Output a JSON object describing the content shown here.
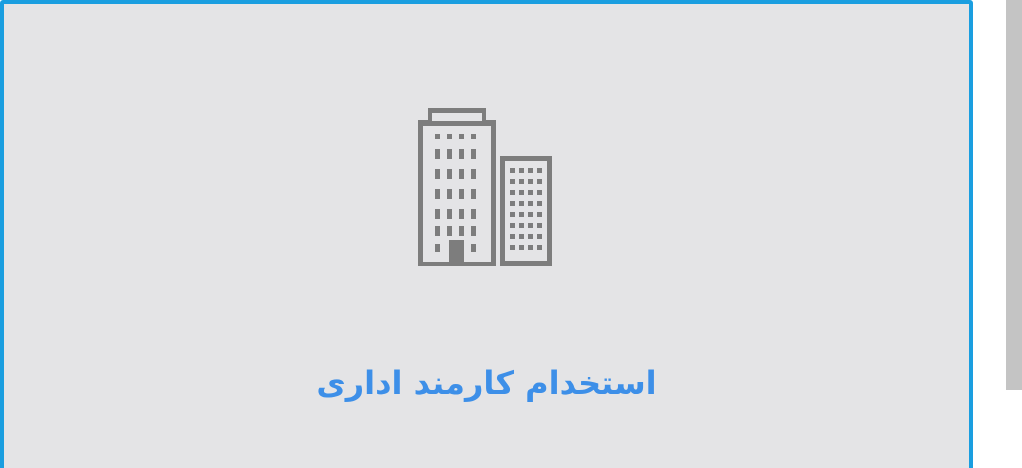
{
  "card": {
    "title": "استخدام کارمند اداری",
    "icon": "office-building-icon"
  },
  "colors": {
    "card_background": "#e4e4e6",
    "card_border": "#1a9ee0",
    "title_text": "#3d8fe8",
    "icon": "#7d7d7d",
    "scrollbar_thumb": "#c4c4c4"
  }
}
